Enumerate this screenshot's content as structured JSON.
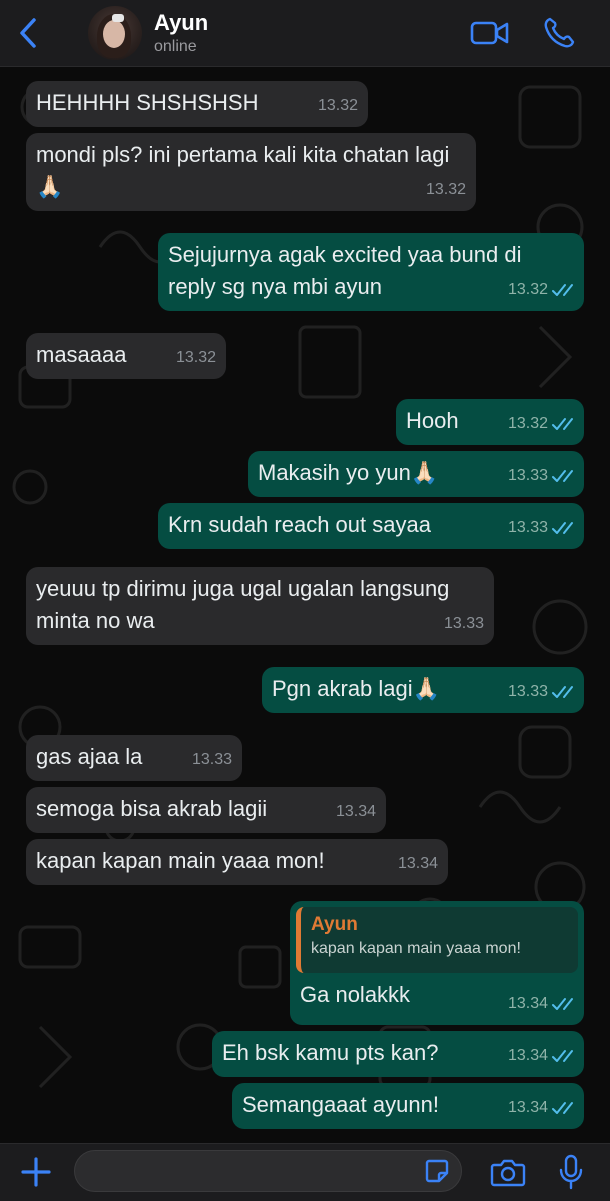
{
  "header": {
    "contact_name": "Ayun",
    "status": "online"
  },
  "messages": [
    {
      "dir": "in",
      "text": "HEHHHH SHSHSHSH",
      "time": "13.32"
    },
    {
      "dir": "in",
      "text": "mondi pls? ini pertama kali kita chatan lagi🙏🏻",
      "time": "13.32"
    },
    {
      "dir": "out",
      "text": "Sejujurnya agak excited yaa bund di reply sg nya mbi ayun",
      "time": "13.32",
      "read": true
    },
    {
      "dir": "in",
      "text": "masaaaa",
      "time": "13.32"
    },
    {
      "dir": "out",
      "text": "Hooh",
      "time": "13.32",
      "read": true
    },
    {
      "dir": "out",
      "text": "Makasih yo yun🙏🏻",
      "time": "13.33",
      "read": true
    },
    {
      "dir": "out",
      "text": "Krn sudah reach out sayaa",
      "time": "13.33",
      "read": true
    },
    {
      "dir": "in",
      "text": "yeuuu tp dirimu juga ugal ugalan langsung minta no wa",
      "time": "13.33"
    },
    {
      "dir": "out",
      "text": "Pgn akrab lagi🙏🏻",
      "time": "13.33",
      "read": true
    },
    {
      "dir": "in",
      "text": "gas ajaa la",
      "time": "13.33"
    },
    {
      "dir": "in",
      "text": "semoga bisa akrab lagii",
      "time": "13.34"
    },
    {
      "dir": "in",
      "text": "kapan kapan main yaaa mon!",
      "time": "13.34"
    },
    {
      "dir": "out",
      "text": "Ga nolakkk",
      "time": "13.34",
      "read": true,
      "quote": {
        "name": "Ayun",
        "text": "kapan kapan main yaaa mon!"
      }
    },
    {
      "dir": "out",
      "text": "Eh bsk kamu pts kan?",
      "time": "13.34",
      "read": true
    },
    {
      "dir": "out",
      "text": "Semangaaat ayunn!",
      "time": "13.34",
      "read": true
    }
  ],
  "composer": {
    "value": "",
    "placeholder": ""
  },
  "colors": {
    "incoming_bubble": "#2a2a2c",
    "outgoing_bubble": "#054d42",
    "accent_blue": "#3b82f6",
    "read_ticks": "#53bdeb",
    "quote_accent": "#e07a34"
  },
  "icons": {
    "back": "chevron-left-icon",
    "video": "video-camera-icon",
    "call": "phone-icon",
    "plus": "plus-icon",
    "sticker": "sticker-icon",
    "camera": "camera-icon",
    "mic": "microphone-icon",
    "ticks": "double-check-icon"
  }
}
